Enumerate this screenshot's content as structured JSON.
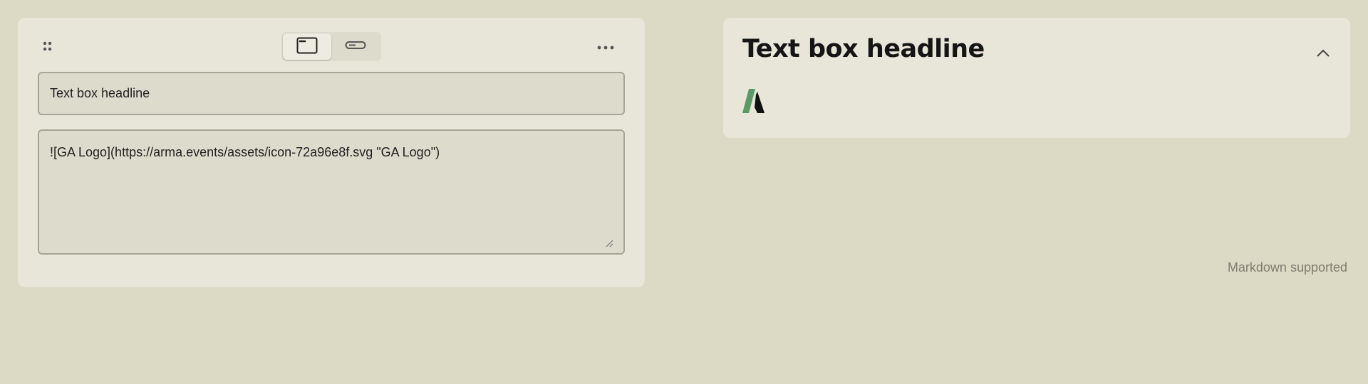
{
  "editor": {
    "headline_value": "Text box headline",
    "body_value": "![GA Logo](https://arma.events/assets/icon-72a96e8f.svg \"GA Logo\")",
    "markdown_note": "Markdown supported",
    "view_toggle": {
      "selected": "card-view",
      "options": [
        "card-view-icon",
        "inline-view-icon"
      ]
    },
    "icons": {
      "drag": "drag-handle-icon",
      "more": "more-horizontal-icon",
      "resize": "resize-grip-icon"
    }
  },
  "preview": {
    "title": "Text box headline",
    "image_alt": "GA Logo",
    "icons": {
      "collapse": "chevron-up-icon"
    }
  },
  "colors": {
    "background": "#dcdac4",
    "card": "#e8e6d8",
    "field": "#dddbcc",
    "field_border": "#a7a597",
    "logo_green": "#5a9a67",
    "logo_black": "#111111"
  }
}
